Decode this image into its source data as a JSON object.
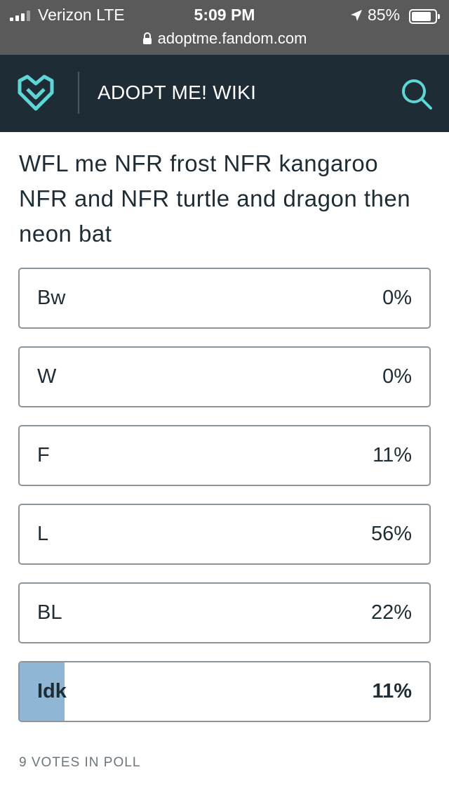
{
  "status_bar": {
    "carrier": "Verizon  LTE",
    "time": "5:09 PM",
    "battery": "85%",
    "battery_level": 0.85,
    "url": "adoptme.fandom.com"
  },
  "header": {
    "title": "ADOPT ME! WIKI",
    "logo_icon": "fandom-heart-logo-icon",
    "search_icon": "search-icon",
    "accent_color": "#5fd6d6",
    "background_color": "#1e2c35"
  },
  "poll": {
    "question": "WFL me NFR frost NFR kangaroo NFR and NFR turtle and dragon then neon bat",
    "options": [
      {
        "label": "Bw",
        "percent": "0%",
        "value": 0,
        "selected": false
      },
      {
        "label": "W",
        "percent": "0%",
        "value": 0,
        "selected": false
      },
      {
        "label": "F",
        "percent": "11%",
        "value": 11,
        "selected": false
      },
      {
        "label": "L",
        "percent": "56%",
        "value": 56,
        "selected": false
      },
      {
        "label": "BL",
        "percent": "22%",
        "value": 22,
        "selected": false
      },
      {
        "label": "Idk",
        "percent": "11%",
        "value": 11,
        "selected": true
      }
    ],
    "selected_bar_color": "#8fb6d4",
    "votes": "9 VOTES IN POLL"
  }
}
